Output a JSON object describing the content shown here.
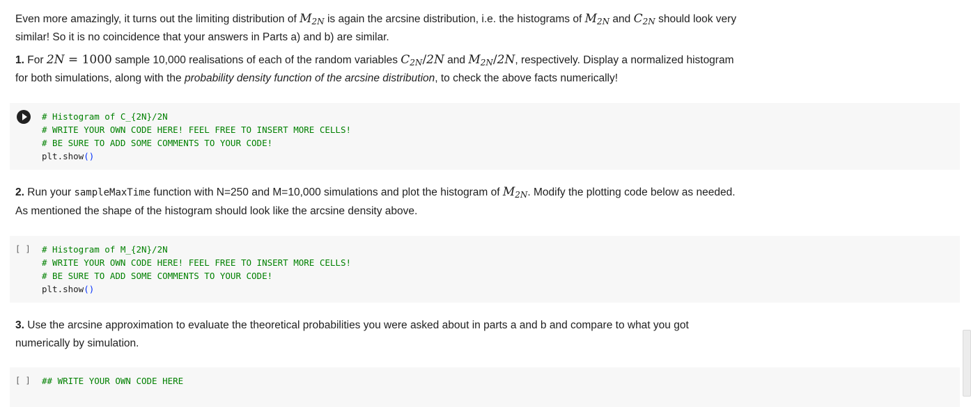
{
  "intro": {
    "t1": "Even more amazingly, it turns out the limiting distribution of ",
    "t2": " is again the arcsine distribution, i.e. the histograms of ",
    "t3": " and ",
    "t4": " should look very similar! So it is no coincidence that your answers in Parts a) and b) are similar."
  },
  "math": {
    "M": "M",
    "C": "C",
    "sub2N": "2N",
    "twoN": "2N",
    "eq": " = ",
    "n1000": "1000",
    "slash": "/"
  },
  "q1": {
    "num": "1.",
    "t1": " For ",
    "t2": " sample 10,000 realisations of each of the random variables ",
    "t3": " and ",
    "t4": ", respectively. Display a normalized histogram for both simulations, along with the ",
    "em": "probability density function of the arcsine distribution",
    "t5": ", to check the above facts numerically!"
  },
  "cell1": {
    "line1": "# Histogram of C_{2N}/2N",
    "line2": "# WRITE YOUR OWN CODE HERE! FEEL FREE TO INSERT MORE CELLS!",
    "line3": "# BE SURE TO ADD SOME COMMENTS TO YOUR CODE!",
    "call": "plt.show",
    "parens": "()"
  },
  "q2": {
    "num": "2.",
    "t1": " Run your ",
    "code": "sampleMaxTime",
    "t2": " function with N=250 and M=10,000 simulations and plot the histogram of ",
    "t3": ". Modify the plotting code below as needed. As mentioned the shape of the histogram should look like the arcsine density above."
  },
  "cell2": {
    "exec": "[ ]",
    "line1": "# Histogram of M_{2N}/2N",
    "line2": "# WRITE YOUR OWN CODE HERE! FEEL FREE TO INSERT MORE CELLS!",
    "line3": "# BE SURE TO ADD SOME COMMENTS TO YOUR CODE!",
    "call": "plt.show",
    "parens": "()"
  },
  "q3": {
    "num": "3.",
    "t1": " Use the arcsine approximation to evaluate the theoretical probabilities you were asked about in parts a and b and compare to what you got numerically by simulation."
  },
  "cell3": {
    "exec": "[ ]",
    "line1": "## WRITE YOUR OWN CODE HERE"
  }
}
